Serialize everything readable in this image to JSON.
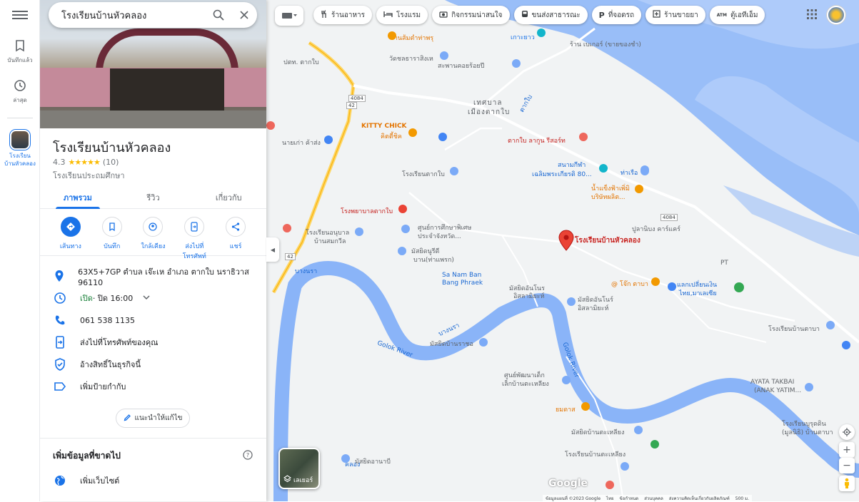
{
  "search": {
    "query": "โรงเรียนบ้านหัวคลอง"
  },
  "rail": {
    "saved": "บันทึกแล้ว",
    "recent": "ล่าสุด",
    "current_place": "โรงเรียนบ้านหัวคลอง"
  },
  "place": {
    "title": "โรงเรียนบ้านหัวคลอง",
    "rating": "4.3",
    "stars": "★★★★★",
    "review_count": "(10)",
    "category": "โรงเรียนประถมศึกษา",
    "tabs": [
      {
        "label": "ภาพรวม",
        "active": true
      },
      {
        "label": "รีวิว",
        "active": false
      },
      {
        "label": "เกี่ยวกับ",
        "active": false
      }
    ],
    "actions": [
      {
        "label": "เส้นทาง",
        "icon": "directions-icon"
      },
      {
        "label": "บันทึก",
        "icon": "bookmark-icon"
      },
      {
        "label": "ใกล้เคียง",
        "icon": "nearby-icon"
      },
      {
        "label": "ส่งไปที่โทรศัพท์",
        "icon": "send-to-phone-icon"
      },
      {
        "label": "แชร์",
        "icon": "share-icon"
      }
    ],
    "address": "63X5+7GP ตำบล เจ๊ะเห อำเภอ ตากใบ นราธิวาส 96110",
    "hours_open": "เปิด",
    "hours_rest": " · ปิด 16:00",
    "phone": "061 538 1135",
    "send_to_phone": "ส่งไปที่โทรศัพท์ของคุณ",
    "claim": "อ้างสิทธิ์ในธุรกิจนี้",
    "add_label": "เพิ่มป้ายกำกับ",
    "suggest_edit": "แนะนำให้แก้ไข",
    "missing_info": "เพิ่มข้อมูลที่ขาดไป",
    "add_website": "เพิ่มเว็บไซต์"
  },
  "map": {
    "chips": [
      {
        "label": "ร้านอาหาร",
        "icon": "fork-knife-icon"
      },
      {
        "label": "โรงแรม",
        "icon": "bed-icon"
      },
      {
        "label": "กิจกรรมน่าสนใจ",
        "icon": "camera-icon"
      },
      {
        "label": "ขนส่งสาธารณะ",
        "icon": "bus-icon"
      },
      {
        "label": "ที่จอดรถ",
        "icon": "parking-icon"
      },
      {
        "label": "ร้านขายยา",
        "icon": "pharmacy-icon"
      },
      {
        "label": "ตู้เอทีเอ็ม",
        "icon": "atm-icon"
      }
    ],
    "atm_prefix": "ATM",
    "parking_prefix": "P",
    "marker_label": "โรงเรียนบ้านหัวคลอง",
    "labels": {
      "tessaban": "เทศบาล",
      "mueang_takbai": "เมืองตากใบ",
      "kitty_chick": "KITTY CHICK",
      "kitty_chick_th": "คิตตี้ชิค",
      "school_takbai": "โรงเรียนตากใบ",
      "hospital": "โรงพยาบาลตากใบ",
      "special_center": "ศูนย์การศึกษาพิเศษ",
      "special_center2": "ประจำจังหวัด...",
      "kindergarten": "โรงเรียนอนุบาล",
      "kindergarten2": "บ้านสมกวีล",
      "mosque_tuddee": "มัสยิดนูรีดี",
      "mosque_tuddee2": "บาน(ท่าแพรก)",
      "sa_nam_ban": "Sa Nam Ban",
      "bang_phraek": "Bang Phraek",
      "mosque_anon": "มัสยิดอันโนร",
      "mosque_anon2": "อิสลามิยะห์",
      "mosque_noor": "มัสยิดอันโนร์",
      "mosque_noor2": "อิสลามิยะห์",
      "mosque_bangrai": "มัสยิดบ้านราชอ",
      "child_center": "ศูนย์พัฒนาเด็ก",
      "child_center2": "เล็กบ้านตะเหลียง",
      "mosque_talieng": "มัสยิดบ้านตะเหลียง",
      "school_talieng": "โรงเรียนบ้านตะเหลียง",
      "mosque_anabi": "มัสยิดอานาบี",
      "ayata": "AYATA TAKBAI",
      "ayata2": "(ANAK YATIM...",
      "school_tavao": "โรงเรียนบ้านตาบา",
      "school_rudin": "โรงเรียนบูรุดดิน",
      "school_rudin2": "(มูลนิธิ) บ้านตาบา",
      "koh_yao": "เกาะยาว",
      "wat_chon": "วัดชลธาราสิงเห",
      "bridge": "สะพานคอยร้อยปี",
      "stadium": "สนามกีฬา",
      "stadium2": "เฉลิมพระเกียรติ 80...",
      "ice": "น้ำแข็งฟ้าเพิ่มิ",
      "ice2": "บริษัทผลิต...",
      "pulanin": "ปูลานิบง คาร์แคร์",
      "tha_rua": "ท่าเรือ",
      "exchange": "แลกเปลี่ยนเงิน",
      "exchange2": "ไทย,มาเลเซีย",
      "jo_takba": "@ โจ๊ก ตาบา",
      "yomdad": "ยมดาส",
      "ton_som": "ร้านส้มตำท่าพรุ",
      "nai_kao": "นายเก่า ค้าส่ง",
      "resort": "ตากใบ ลากูน รีสอร์ท",
      "pattani_cc": "ปตท. ตากใบ",
      "rv_golok": "Golok River",
      "rv_golok2": "Golok River",
      "rv_thai": "บางนรา",
      "rv_thai2": "บางนรา",
      "route42": "42",
      "route4084": "4084",
      "takbai_river": "ตากใบ",
      "pt": "PT",
      "rf_bao": "ร้าน เบเกอร์ (ขายของชำ)",
      "klong": "คลอง"
    },
    "layers_label": "เลเยอร์",
    "google": "Google",
    "footer": [
      "ข้อมูลแผนที่ ©2023 Google",
      "ไทย",
      "ข้อกำหนด",
      "ส่วนบุคคล",
      "ส่งความคิดเห็นเกี่ยวกับผลิตภัณฑ์",
      "500 ม."
    ]
  }
}
